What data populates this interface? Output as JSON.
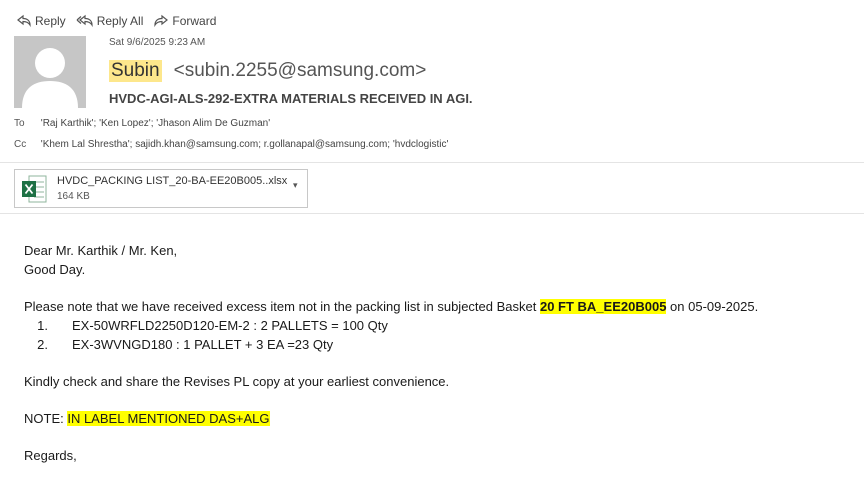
{
  "toolbar": {
    "reply_label": "Reply",
    "reply_all_label": "Reply All",
    "forward_label": "Forward"
  },
  "header": {
    "date": "Sat 9/6/2025 9:23 AM",
    "sender_name": "Subin",
    "sender_email": "<subin.2255@samsung.com>",
    "subject": "HVDC-AGI-ALS-292-EXTRA MATERIALS RECEIVED IN AGI.",
    "to_label": "To",
    "to_value": "'Raj Karthik'; 'Ken Lopez'; 'Jhason Alim De Guzman'",
    "cc_label": "Cc",
    "cc_value": "'Khem Lal Shrestha'; sajidh.khan@samsung.com; r.gollanapal@samsung.com; 'hvdclogistic'"
  },
  "attachment": {
    "filename": "HVDC_PACKING LIST_20-BA-EE20B005..xlsx",
    "size": "164 KB"
  },
  "body": {
    "greeting": "Dear Mr. Karthik / Mr. Ken,",
    "good_day": "Good Day.",
    "para1_before": "Please note that we have received excess item not in the packing list in subjected Basket ",
    "para1_highlight": "20 FT BA_EE20B005",
    "para1_after": " on 05-09-2025.",
    "items": [
      {
        "num": "1.",
        "text": "EX-50WRFLD2250D120-EM-2 : 2 PALLETS = 100 Qty"
      },
      {
        "num": "2.",
        "text": "EX-3WVNGD180 : 1 PALLET + 3 EA =23 Qty"
      }
    ],
    "para2": "Kindly check and share the Revises PL copy at your earliest convenience.",
    "note_label": "NOTE: ",
    "note_highlight": "IN LABEL MENTIONED DAS+ALG",
    "closing": "Regards,"
  }
}
